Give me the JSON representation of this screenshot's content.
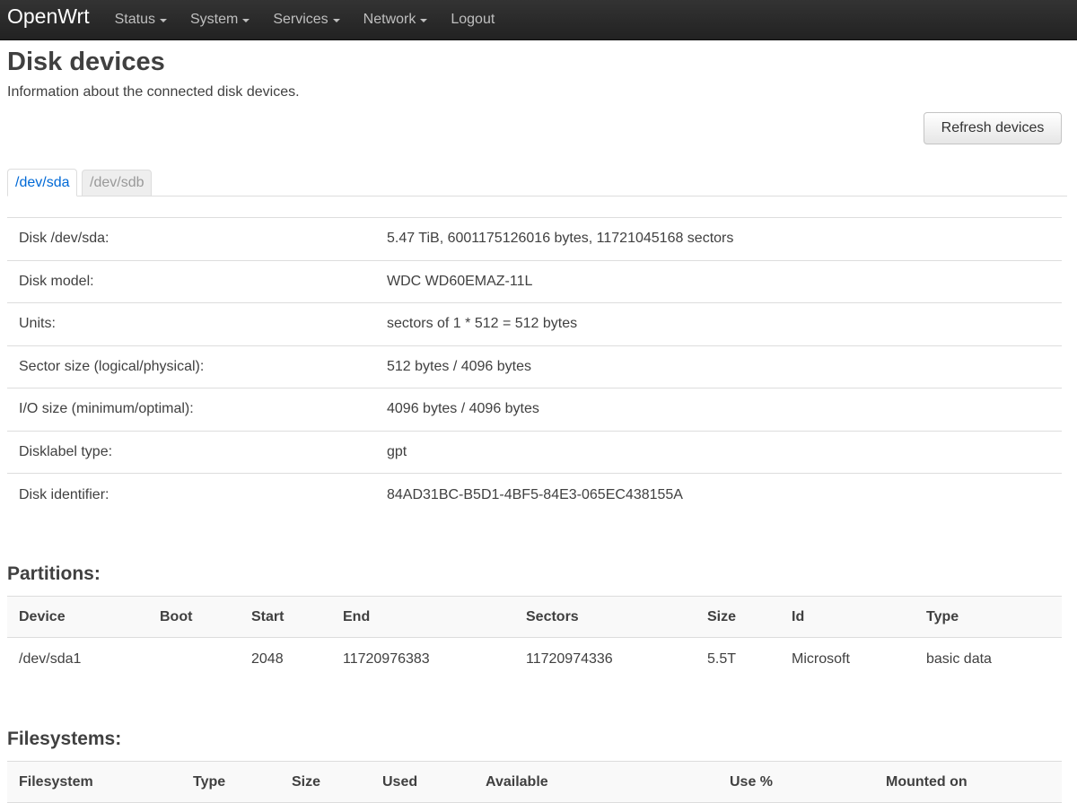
{
  "nav": {
    "brand": "OpenWrt",
    "items": [
      {
        "label": "Status",
        "dropdown": true
      },
      {
        "label": "System",
        "dropdown": true
      },
      {
        "label": "Services",
        "dropdown": true
      },
      {
        "label": "Network",
        "dropdown": true
      },
      {
        "label": "Logout",
        "dropdown": false
      }
    ]
  },
  "page": {
    "title": "Disk devices",
    "description": "Information about the connected disk devices.",
    "refresh_label": "Refresh devices"
  },
  "tabs": [
    {
      "label": "/dev/sda",
      "active": true
    },
    {
      "label": "/dev/sdb",
      "active": false
    }
  ],
  "disk_info": [
    {
      "label": "Disk /dev/sda:",
      "value": "5.47 TiB, 6001175126016 bytes, 11721045168 sectors"
    },
    {
      "label": "Disk model:",
      "value": "WDC WD60EMAZ-11L"
    },
    {
      "label": "Units:",
      "value": "sectors of 1 * 512 = 512 bytes"
    },
    {
      "label": "Sector size (logical/physical):",
      "value": "512 bytes / 4096 bytes"
    },
    {
      "label": "I/O size (minimum/optimal):",
      "value": "4096 bytes / 4096 bytes"
    },
    {
      "label": "Disklabel type:",
      "value": "gpt"
    },
    {
      "label": "Disk identifier:",
      "value": "84AD31BC-B5D1-4BF5-84E3-065EC438155A"
    }
  ],
  "partitions": {
    "title": "Partitions:",
    "headers": [
      "Device",
      "Boot",
      "Start",
      "End",
      "Sectors",
      "Size",
      "Id",
      "Type"
    ],
    "rows": [
      [
        "/dev/sda1",
        "",
        "2048",
        "11720976383",
        "11720974336",
        "5.5T",
        "Microsoft",
        "basic data"
      ]
    ]
  },
  "filesystems": {
    "title": "Filesystems:",
    "headers": [
      "Filesystem",
      "Type",
      "Size",
      "Used",
      "Available",
      "Use %",
      "Mounted on"
    ],
    "rows": []
  }
}
